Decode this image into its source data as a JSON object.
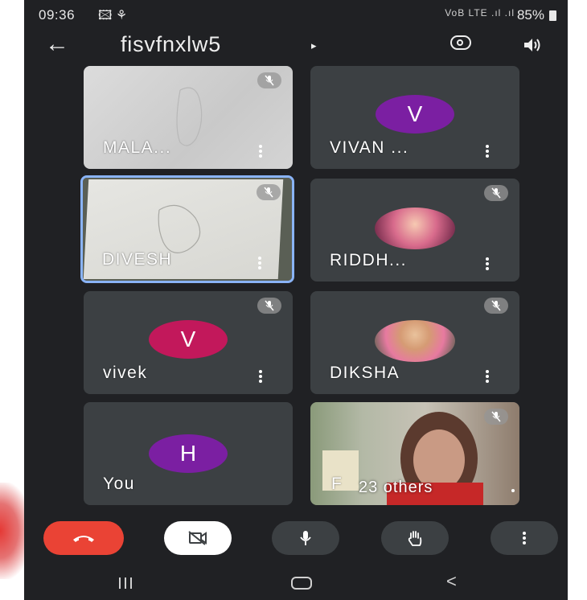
{
  "status_bar": {
    "time": "09:36",
    "left_icons": "🖾 ⚘",
    "network": "VoB LTE .ıl .ıl",
    "battery": "85%"
  },
  "header": {
    "meeting_code": "fisvfnxlw5",
    "caret": "▸"
  },
  "participants": [
    {
      "name": "MALA...",
      "avatar_letter": "",
      "avatar_color": ""
    },
    {
      "name": "VIVAN ...",
      "avatar_letter": "V",
      "avatar_color": "#7b1fa2"
    },
    {
      "name": "DIVESH",
      "avatar_letter": "",
      "avatar_color": ""
    },
    {
      "name": "RIDDH...",
      "avatar_letter": "",
      "avatar_color": ""
    },
    {
      "name": "vivek",
      "avatar_letter": "V",
      "avatar_color": "#c2185b"
    },
    {
      "name": "DIKSHA",
      "avatar_letter": "",
      "avatar_color": ""
    },
    {
      "name": "You",
      "avatar_letter": "H",
      "avatar_color": "#7b1fa2"
    },
    {
      "name": "F",
      "avatar_letter": "",
      "avatar_color": ""
    }
  ],
  "others_label": "23 others",
  "colors": {
    "end_call": "#ea4335",
    "active_border": "#8ab4f8",
    "background": "#202124",
    "tile": "#3c4043"
  },
  "icons": {
    "end_call": "phone-hangup-icon",
    "camera": "video-off-icon",
    "mic": "microphone-icon",
    "hand": "raise-hand-icon",
    "more": "more-vertical-icon"
  },
  "nav_back": "<"
}
